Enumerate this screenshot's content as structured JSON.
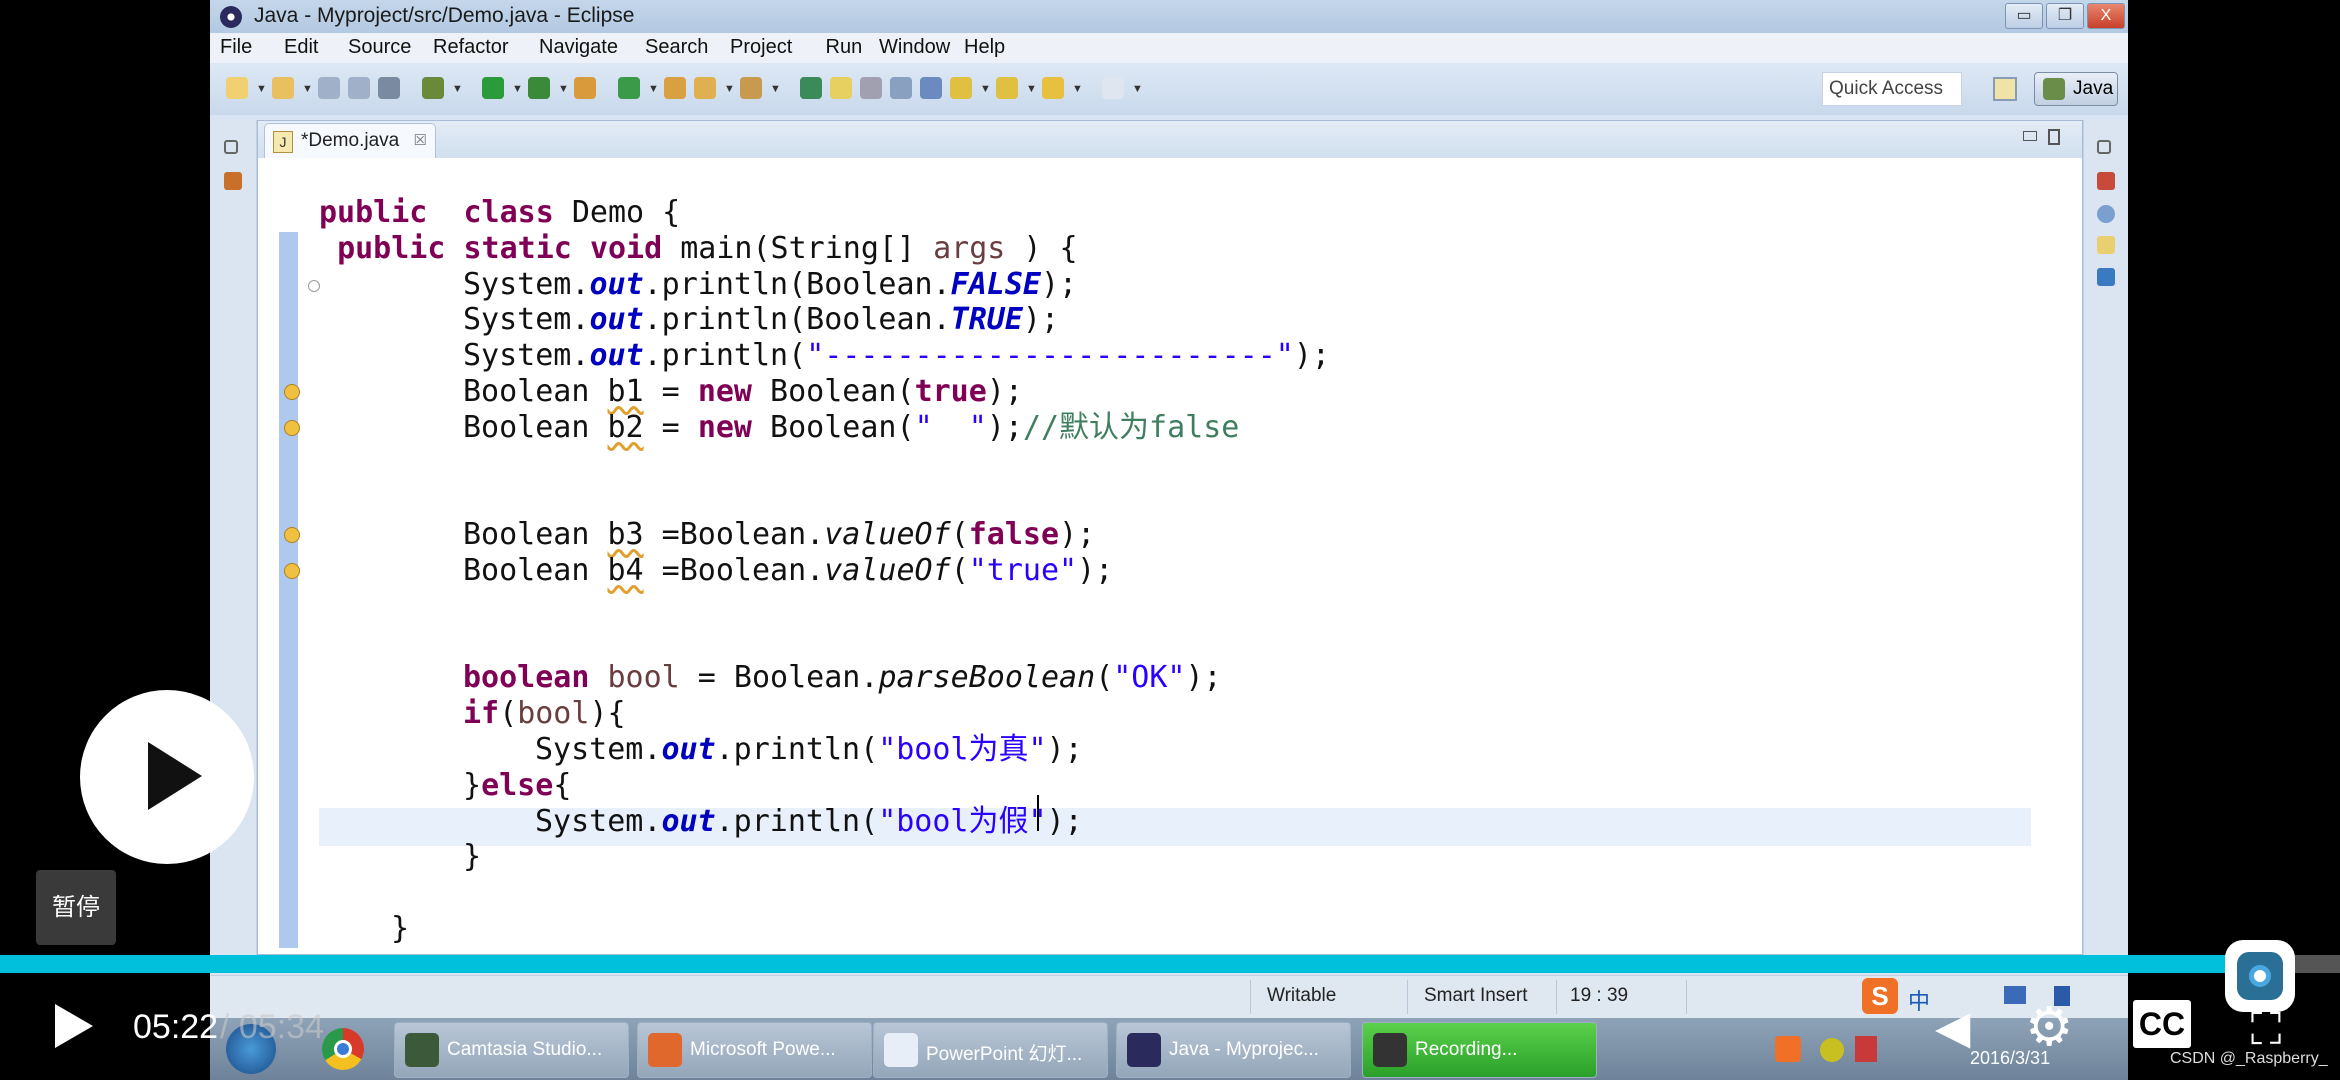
{
  "window": {
    "title": "Java - Myproject/src/Demo.java - Eclipse",
    "controls": {
      "minimize": "▭",
      "restore": "❐",
      "close": "X"
    }
  },
  "menu": [
    "File",
    "Edit",
    "Source",
    "Refactor",
    "Navigate",
    "Search",
    "Project",
    "Run",
    "Window",
    "Help"
  ],
  "toolbar": {
    "icons": [
      "new-icon",
      "new-type-icon",
      "save-icon",
      "save-all-icon",
      "skip-breakpoints-icon",
      "debug-icon",
      "run-icon",
      "run-external-tool-icon",
      "new-java-package-icon",
      "new-class-icon",
      "open-type-icon",
      "open-task-icon",
      "search-icon",
      "toggle-mark-occurrences-icon",
      "toggle-highlight-icon",
      "show-whitespace-icon",
      "block-selection-icon",
      "show-paragraph-icon",
      "next-annotation-icon",
      "previous-annotation-icon",
      "back-icon",
      "forward-icon"
    ],
    "quick_access_placeholder": "Quick Access",
    "perspective_label": "Java"
  },
  "editor": {
    "tab_label": "*Demo.java",
    "tab_close": "☒",
    "lines": [
      [
        [
          "k",
          "public"
        ],
        [
          "",
          "  "
        ],
        [
          "k",
          "class"
        ],
        [
          "",
          " Demo {"
        ]
      ],
      [
        [
          "",
          " "
        ],
        [
          "k",
          "public"
        ],
        [
          "",
          " "
        ],
        [
          "k",
          "static"
        ],
        [
          "",
          " "
        ],
        [
          "k",
          "void"
        ],
        [
          "",
          " main(String[] "
        ],
        [
          "v",
          "args"
        ],
        [
          "",
          " ) {"
        ]
      ],
      [
        [
          "",
          "System."
        ],
        [
          "f",
          "out"
        ],
        [
          "",
          ".println(Boolean."
        ],
        [
          "f",
          "FALSE"
        ],
        [
          "",
          ");"
        ]
      ],
      [
        [
          "",
          "System."
        ],
        [
          "f",
          "out"
        ],
        [
          "",
          ".println(Boolean."
        ],
        [
          "f",
          "TRUE"
        ],
        [
          "",
          ");"
        ]
      ],
      [
        [
          "",
          "System."
        ],
        [
          "f",
          "out"
        ],
        [
          "",
          ".println("
        ],
        [
          "s",
          "\"-------------------------\""
        ],
        [
          "",
          ");"
        ]
      ],
      [
        [
          "",
          "Boolean "
        ],
        [
          "w",
          "b1"
        ],
        [
          "",
          " = "
        ],
        [
          "k",
          "new"
        ],
        [
          "",
          " Boolean("
        ],
        [
          "k",
          "true"
        ],
        [
          "",
          ");"
        ]
      ],
      [
        [
          "",
          "Boolean "
        ],
        [
          "w",
          "b2"
        ],
        [
          "",
          " = "
        ],
        [
          "k",
          "new"
        ],
        [
          "",
          " Boolean("
        ],
        [
          "s",
          "\"  \""
        ],
        [
          "",
          ");"
        ],
        [
          "c",
          "//默认为false"
        ]
      ],
      [],
      [],
      [
        [
          "",
          "Boolean "
        ],
        [
          "w",
          "b3"
        ],
        [
          "",
          " =Boolean."
        ],
        [
          "m",
          "valueOf"
        ],
        [
          "",
          "("
        ],
        [
          "k",
          "false"
        ],
        [
          "",
          ");"
        ]
      ],
      [
        [
          "",
          "Boolean "
        ],
        [
          "w",
          "b4"
        ],
        [
          "",
          " =Boolean."
        ],
        [
          "m",
          "valueOf"
        ],
        [
          "",
          "("
        ],
        [
          "s",
          "\"true\""
        ],
        [
          "",
          ");"
        ]
      ],
      [],
      [],
      [
        [
          "k",
          "boolean"
        ],
        [
          "",
          " "
        ],
        [
          "v",
          "bool"
        ],
        [
          "",
          " = Boolean."
        ],
        [
          "m",
          "parseBoolean"
        ],
        [
          "",
          "("
        ],
        [
          "s",
          "\"OK\""
        ],
        [
          "",
          ");"
        ]
      ],
      [
        [
          "k",
          "if"
        ],
        [
          "",
          "("
        ],
        [
          "v",
          "bool"
        ],
        [
          "",
          "){"
        ]
      ],
      [
        [
          "",
          "System."
        ],
        [
          "f",
          "out"
        ],
        [
          "",
          ".println("
        ],
        [
          "s",
          "\"bool为真\""
        ],
        [
          "",
          ");"
        ]
      ],
      [
        [
          "",
          "}"
        ],
        [
          "k",
          "else"
        ],
        [
          "",
          "{"
        ]
      ],
      [
        [
          "",
          "System."
        ],
        [
          "f",
          "out"
        ],
        [
          "",
          ".println("
        ],
        [
          "s",
          "\"bool为假\""
        ],
        [
          "",
          ");"
        ]
      ],
      [
        [
          "",
          "}"
        ]
      ],
      [],
      [
        [
          "",
          "}"
        ]
      ]
    ],
    "indents": [
      0,
      0,
      2,
      2,
      2,
      2,
      2,
      0,
      0,
      2,
      2,
      0,
      0,
      2,
      2,
      3,
      2,
      3,
      2,
      0,
      1
    ]
  },
  "status": {
    "writable": "Writable",
    "insert_mode": "Smart Insert",
    "position": "19 : 39"
  },
  "taskbar": {
    "items": [
      {
        "label": "Camtasia Studio...",
        "icon": "camtasia-icon",
        "color": "#3c5a3a"
      },
      {
        "label": "Microsoft Powe...",
        "icon": "powerpoint-icon",
        "color": "#e0682c"
      },
      {
        "label": "PowerPoint 幻灯...",
        "icon": "powerpoint-slide-icon",
        "color": "#e8eef7"
      },
      {
        "label": "Java - Myprojec...",
        "icon": "eclipse-icon",
        "color": "#2b2a5c"
      },
      {
        "label": "Recording...",
        "icon": "recording-icon",
        "color": "#333333"
      }
    ],
    "date": "2016/3/31"
  },
  "player": {
    "pause_tooltip": "暂停",
    "current_time": "05:22",
    "total_time": "/ 05:34",
    "progress_percent": 96.6,
    "cc_label": "CC",
    "accent_color": "#00c0dc"
  },
  "watermark": "CSDN @_Raspberry_"
}
